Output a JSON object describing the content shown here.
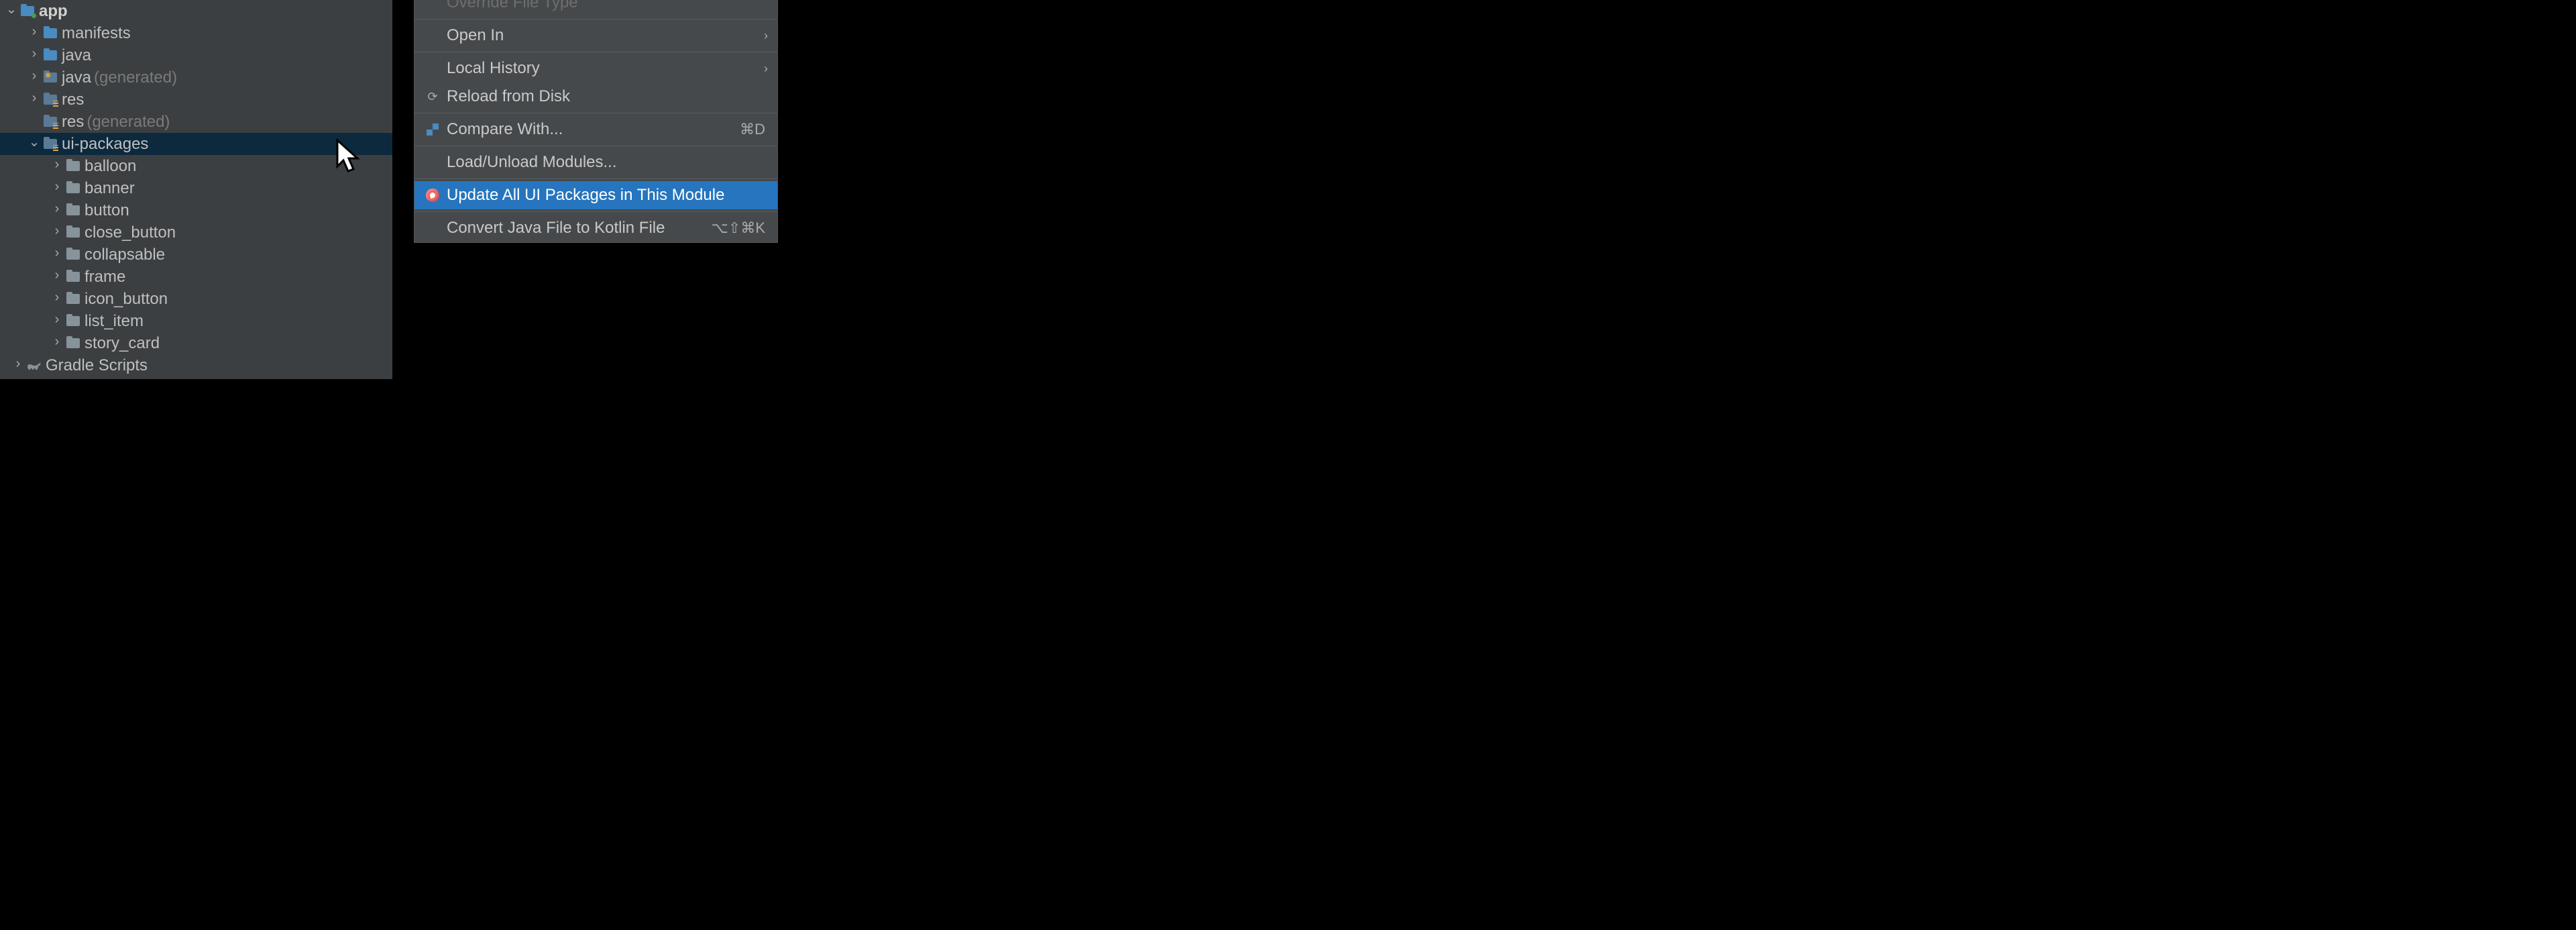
{
  "tree": {
    "app": "app",
    "manifests": "manifests",
    "java": "java",
    "java_gen": "java",
    "generated": "(generated)",
    "res": "res",
    "res_gen": "res",
    "ui_packages": "ui-packages",
    "balloon": "balloon",
    "banner": "banner",
    "button": "button",
    "close_button": "close_button",
    "collapsable": "collapsable",
    "frame": "frame",
    "icon_button": "icon_button",
    "list_item": "list_item",
    "story_card": "story_card",
    "gradle_scripts": "Gradle Scripts"
  },
  "menu": {
    "override_file_type": "Override File Type",
    "open_in": "Open In",
    "local_history": "Local History",
    "reload_from_disk": "Reload from Disk",
    "compare_with": "Compare With...",
    "compare_shortcut": "⌘D",
    "load_unload": "Load/Unload Modules...",
    "update_ui_packages": "Update All UI Packages in This Module",
    "convert_java_kotlin": "Convert Java File to Kotlin File",
    "convert_shortcut": "⌥⇧⌘K"
  }
}
